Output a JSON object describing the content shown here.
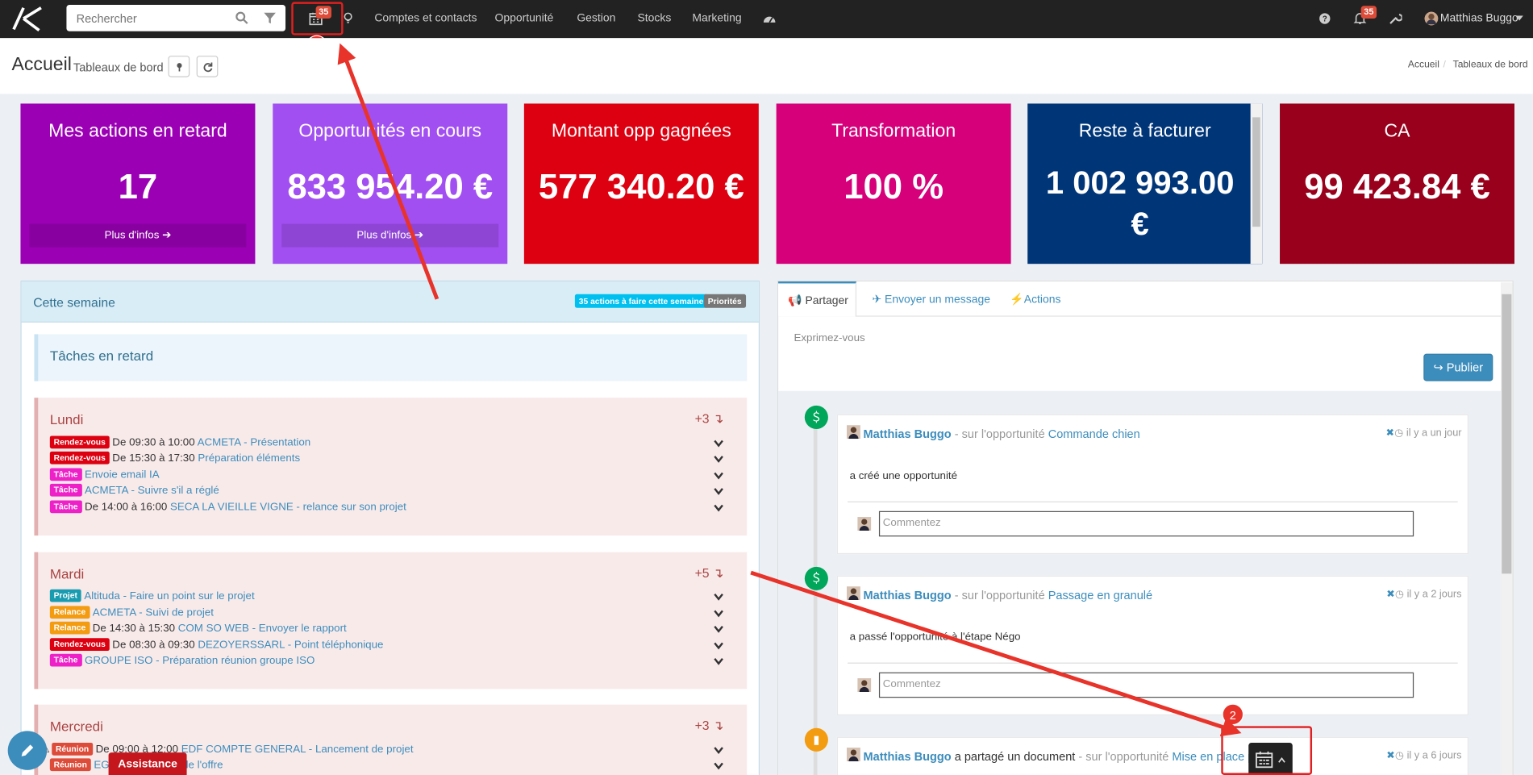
{
  "topbar": {
    "search_placeholder": "Rechercher",
    "calendar_badge": "35",
    "notif_badge": "35",
    "menu": [
      "Comptes et contacts",
      "Opportunité",
      "Gestion",
      "Stocks",
      "Marketing"
    ],
    "user_name": "Matthias Buggo"
  },
  "annotations": {
    "marker1": "1",
    "marker2": "2"
  },
  "header": {
    "title": "Accueil",
    "subtitle": "Tableaux de bord",
    "breadcrumb_home": "Accueil",
    "breadcrumb_sep": "/",
    "breadcrumb_current": "Tableaux de bord"
  },
  "kpis": [
    {
      "title": "Mes actions en retard",
      "value": "17",
      "more": "Plus d'infos",
      "color": "#9b00b5"
    },
    {
      "title": "Opportunités en cours",
      "value": "833 954.20 €",
      "more": "Plus d'infos",
      "color": "#a24ff2"
    },
    {
      "title": "Montant opp gagnées",
      "value": "577 340.20 €",
      "color": "#dd0010"
    },
    {
      "title": "Transformation",
      "value": "100 %",
      "color": "#d5007a"
    },
    {
      "title": "Reste à facturer",
      "value_line1": "1 002 993.00",
      "value_line2": "€",
      "color": "#003578"
    },
    {
      "title": "CA",
      "value": "99 423.84 €",
      "color": "#98001b"
    }
  ],
  "week": {
    "title": "Cette semaine",
    "badge_actions": "35 actions à faire cette semaine",
    "badge_priorities": "Priorités",
    "late_title": "Tâches en retard",
    "days": [
      {
        "name": "Lundi",
        "count": "+3",
        "rows": [
          {
            "tag": "Rendez-vous",
            "tag_color": "#dd0010",
            "time": "De 09:30 à 10:00 ",
            "link": "ACMETA - Présentation"
          },
          {
            "tag": "Rendez-vous",
            "tag_color": "#dd0010",
            "time": "De 15:30 à 17:30 ",
            "link": "Préparation éléments"
          },
          {
            "tag": "Tâche",
            "tag_color": "#ee20c8",
            "time": "",
            "link": "Envoie email IA"
          },
          {
            "tag": "Tâche",
            "tag_color": "#ee20c8",
            "time": "",
            "link": "ACMETA - Suivre s'il a réglé"
          },
          {
            "tag": "Tâche",
            "tag_color": "#ee20c8",
            "time": "De 14:00 à 16:00 ",
            "link": "SECA LA VIEILLE VIGNE - relance sur son projet"
          }
        ]
      },
      {
        "name": "Mardi",
        "count": "+5",
        "rows": [
          {
            "tag": "Projet",
            "tag_color": "#1a9cb0",
            "time": "",
            "link": "Altituda - Faire un point sur le projet"
          },
          {
            "tag": "Relance",
            "tag_color": "#f39c12",
            "time": "",
            "link": "ACMETA - Suivi de projet"
          },
          {
            "tag": "Relance",
            "tag_color": "#f39c12",
            "time": "De 14:30 à 15:30 ",
            "link": "COM SO WEB - Envoyer le rapport"
          },
          {
            "tag": "Rendez-vous",
            "tag_color": "#dd0010",
            "time": "De 08:30 à 09:30 ",
            "link": "DEZOYERSSARL - Point téléphonique"
          },
          {
            "tag": "Tâche",
            "tag_color": "#ee20c8",
            "time": "",
            "link": "GROUPE ISO - Préparation réunion groupe ISO"
          }
        ]
      },
      {
        "name": "Mercredi",
        "count": "+3",
        "rows": [
          {
            "tag": "Réunion",
            "tag_color": "#dd4b39",
            "time": "De 09:00 à 12:00 ",
            "link": "EDF COMPTE GENERAL - Lancement de projet"
          },
          {
            "tag": "Réunion",
            "tag_color": "#dd4b39",
            "time": "",
            "link": "EGC - Mise à jour de l'offre"
          }
        ]
      }
    ]
  },
  "feed": {
    "tabs": [
      "Partager",
      "Envoyer un message",
      "Actions"
    ],
    "placeholder": "Exprimez-vous",
    "publish": "Publier",
    "comment_placeholder": "Commentez",
    "items": [
      {
        "author": "Matthias Buggo",
        "verb": " - sur l'opportunité ",
        "target": "Commande chien",
        "time": "il y a un jour",
        "body": "a créé une opportunité"
      },
      {
        "author": "Matthias Buggo",
        "verb": " - sur l'opportunité ",
        "target": "Passage en granulé",
        "time": "il y a 2 jours",
        "body": "a passé l'opportunité à l'étape Négo"
      },
      {
        "author": "Matthias Buggo",
        "shared": " a partagé un document",
        "verb": " - sur l'opportunité ",
        "target": "Mise en place plan",
        "time": "il y a 6 jours"
      }
    ]
  },
  "footer": {
    "assistance": "Assistance"
  }
}
